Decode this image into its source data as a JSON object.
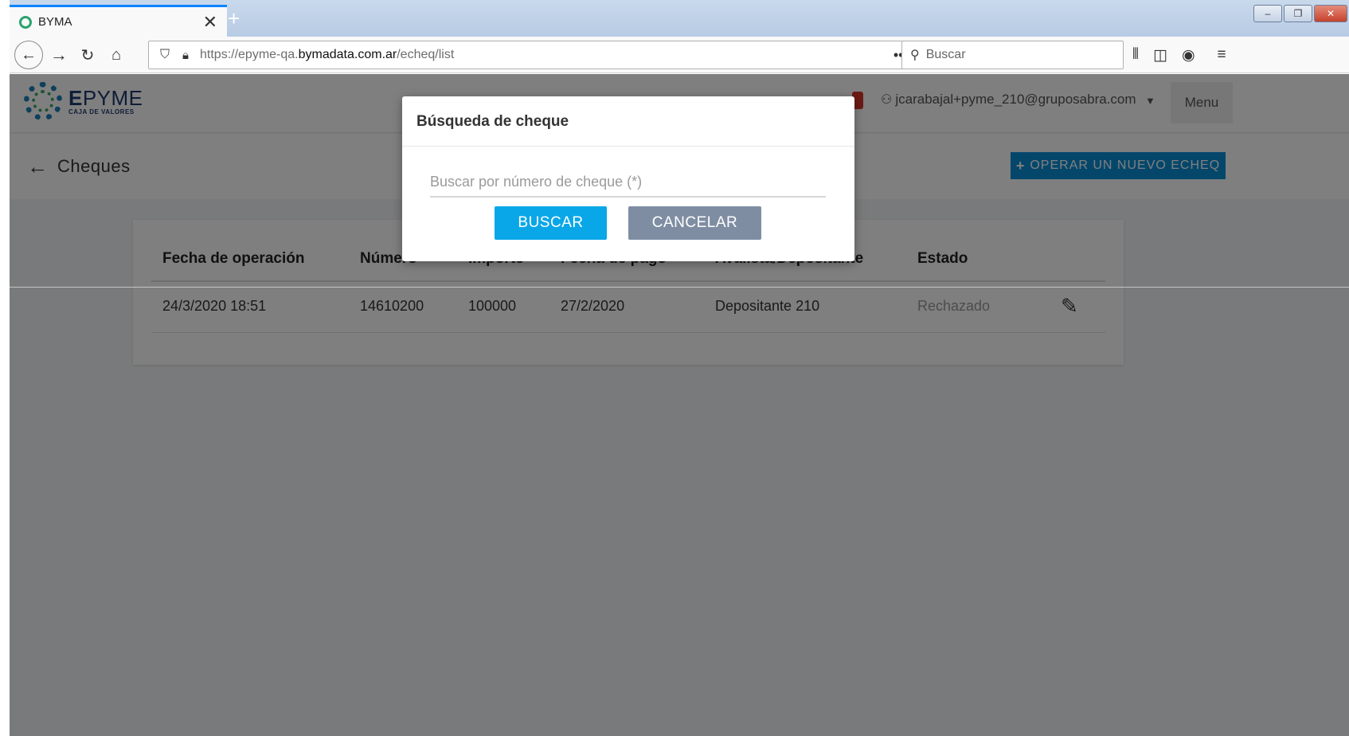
{
  "browser": {
    "tab_title": "BYMA",
    "tab_close": "✕",
    "new_tab": "+",
    "url_prefix": "https://epyme-qa.",
    "url_host": "bymadata.com.ar",
    "url_path": "/echeq/list",
    "search_placeholder": "Buscar",
    "window_controls": [
      "–",
      "❐",
      "✕"
    ]
  },
  "app": {
    "logo_name_bold": "E",
    "logo_name_rest": "PYME",
    "logo_subtitle": "CAJA DE VALORES",
    "user_email": "jcarabajal+pyme_210@gruposabra.com",
    "menu_label": "Menu",
    "section_title": "Cheques",
    "new_echeq_label": "OPERAR UN NUEVO ECHEQ",
    "new_echeq_icon": "+"
  },
  "table": {
    "headers": [
      "Fecha de operación",
      "Número",
      "Importe",
      "Fecha de pago",
      "Avalista/Depositante",
      "Estado"
    ],
    "rows": [
      {
        "fecha_operacion": "24/3/2020 18:51",
        "numero": "14610200",
        "importe": "100000",
        "fecha_pago": "27/2/2020",
        "avalista_depositante": "Depositante 210",
        "estado": "Rechazado"
      }
    ]
  },
  "modal": {
    "title": "Búsqueda de cheque",
    "input_placeholder": "Buscar por número de cheque (*)",
    "input_value": "",
    "buscar_label": "BUSCAR",
    "cancelar_label": "CANCELAR"
  },
  "colors": {
    "primary": "#0aa7e8",
    "secondary": "#7f8da3",
    "status_rejected": "#999999"
  }
}
